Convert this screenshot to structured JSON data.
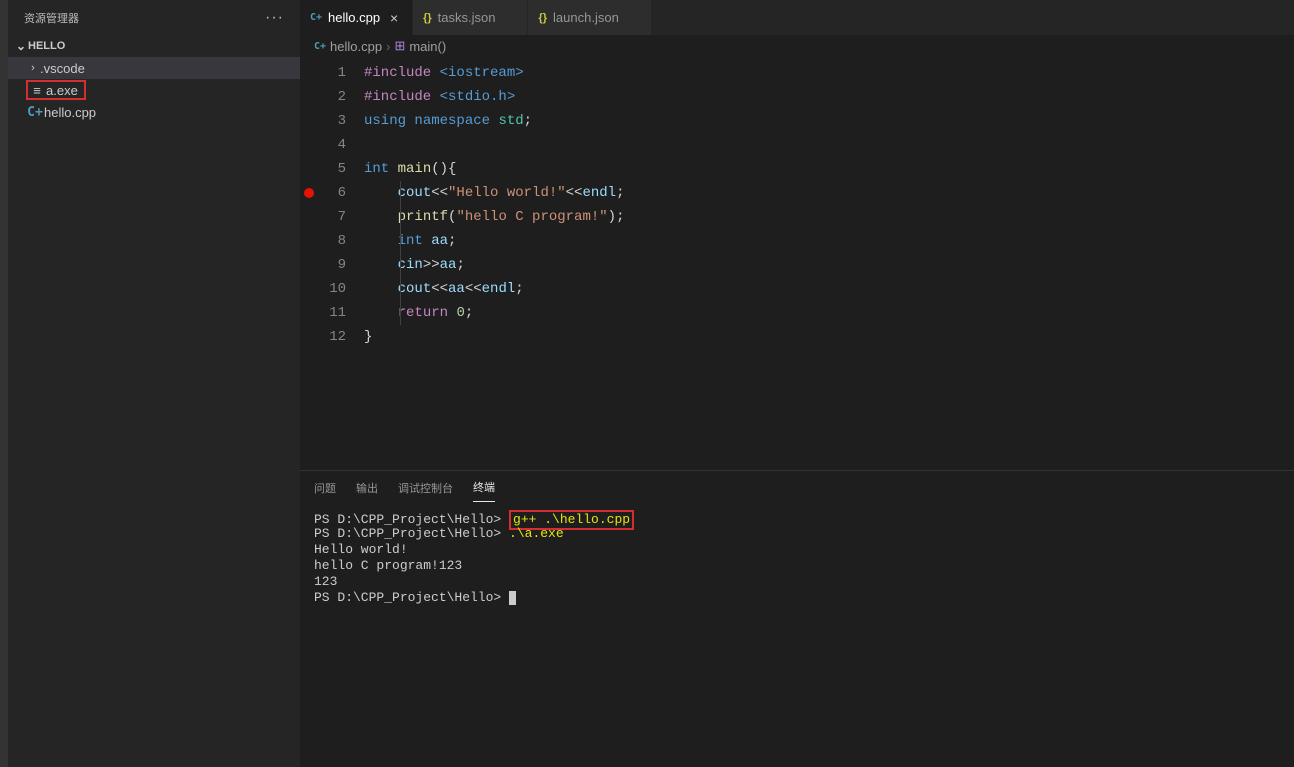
{
  "sidebar": {
    "title": "资源管理器",
    "section": "HELLO",
    "items": [
      {
        "label": ".vscode",
        "kind": "folder"
      },
      {
        "label": "a.exe",
        "kind": "exe"
      },
      {
        "label": "hello.cpp",
        "kind": "cpp"
      }
    ]
  },
  "tabs": [
    {
      "label": "hello.cpp",
      "icon": "cpp",
      "active": true
    },
    {
      "label": "tasks.json",
      "icon": "json",
      "active": false
    },
    {
      "label": "launch.json",
      "icon": "json",
      "active": false
    }
  ],
  "breadcrumb": {
    "file": "hello.cpp",
    "symbol": "main()"
  },
  "editor": {
    "line_count": 12,
    "breakpoint_line": 6,
    "code_tokens": [
      [
        [
          "pp",
          "#include"
        ],
        [
          "p",
          " "
        ],
        [
          "inc",
          "<iostream>"
        ]
      ],
      [
        [
          "pp",
          "#include"
        ],
        [
          "p",
          " "
        ],
        [
          "inc",
          "<stdio.h>"
        ]
      ],
      [
        [
          "kw",
          "using"
        ],
        [
          "p",
          " "
        ],
        [
          "kw",
          "namespace"
        ],
        [
          "p",
          " "
        ],
        [
          "ns",
          "std"
        ],
        [
          "p",
          ";"
        ]
      ],
      [],
      [
        [
          "kw",
          "int"
        ],
        [
          "p",
          " "
        ],
        [
          "fn",
          "main"
        ],
        [
          "p",
          "(){"
        ],
        [
          "__guide",
          ""
        ]
      ],
      [
        [
          "p",
          "    "
        ],
        [
          "var",
          "cout"
        ],
        [
          "op",
          "<<"
        ],
        [
          "str",
          "\"Hello world!\""
        ],
        [
          "op",
          "<<"
        ],
        [
          "var",
          "endl"
        ],
        [
          "p",
          ";"
        ]
      ],
      [
        [
          "p",
          "    "
        ],
        [
          "fn",
          "printf"
        ],
        [
          "p",
          "("
        ],
        [
          "str",
          "\"hello C program!\""
        ],
        [
          "p",
          ");"
        ]
      ],
      [
        [
          "p",
          "    "
        ],
        [
          "kw",
          "int"
        ],
        [
          "p",
          " "
        ],
        [
          "var",
          "aa"
        ],
        [
          "p",
          ";"
        ]
      ],
      [
        [
          "p",
          "    "
        ],
        [
          "var",
          "cin"
        ],
        [
          "op",
          ">>"
        ],
        [
          "var",
          "aa"
        ],
        [
          "p",
          ";"
        ]
      ],
      [
        [
          "p",
          "    "
        ],
        [
          "var",
          "cout"
        ],
        [
          "op",
          "<<"
        ],
        [
          "var",
          "aa"
        ],
        [
          "op",
          "<<"
        ],
        [
          "var",
          "endl"
        ],
        [
          "p",
          ";"
        ]
      ],
      [
        [
          "p",
          "    "
        ],
        [
          "ctrl",
          "return"
        ],
        [
          "p",
          " "
        ],
        [
          "num",
          "0"
        ],
        [
          "p",
          ";"
        ]
      ],
      [
        [
          "p",
          "}"
        ]
      ]
    ]
  },
  "panel": {
    "tabs": [
      "问题",
      "输出",
      "调试控制台",
      "终端"
    ],
    "active_tab": "终端",
    "terminal": {
      "prompt": "PS D:\\CPP_Project\\Hello> ",
      "cmd1": "g++ .\\hello.cpp",
      "cmd2": ".\\a.exe",
      "out1": "Hello world!",
      "out2": "hello C program!123",
      "out3": "123"
    }
  }
}
